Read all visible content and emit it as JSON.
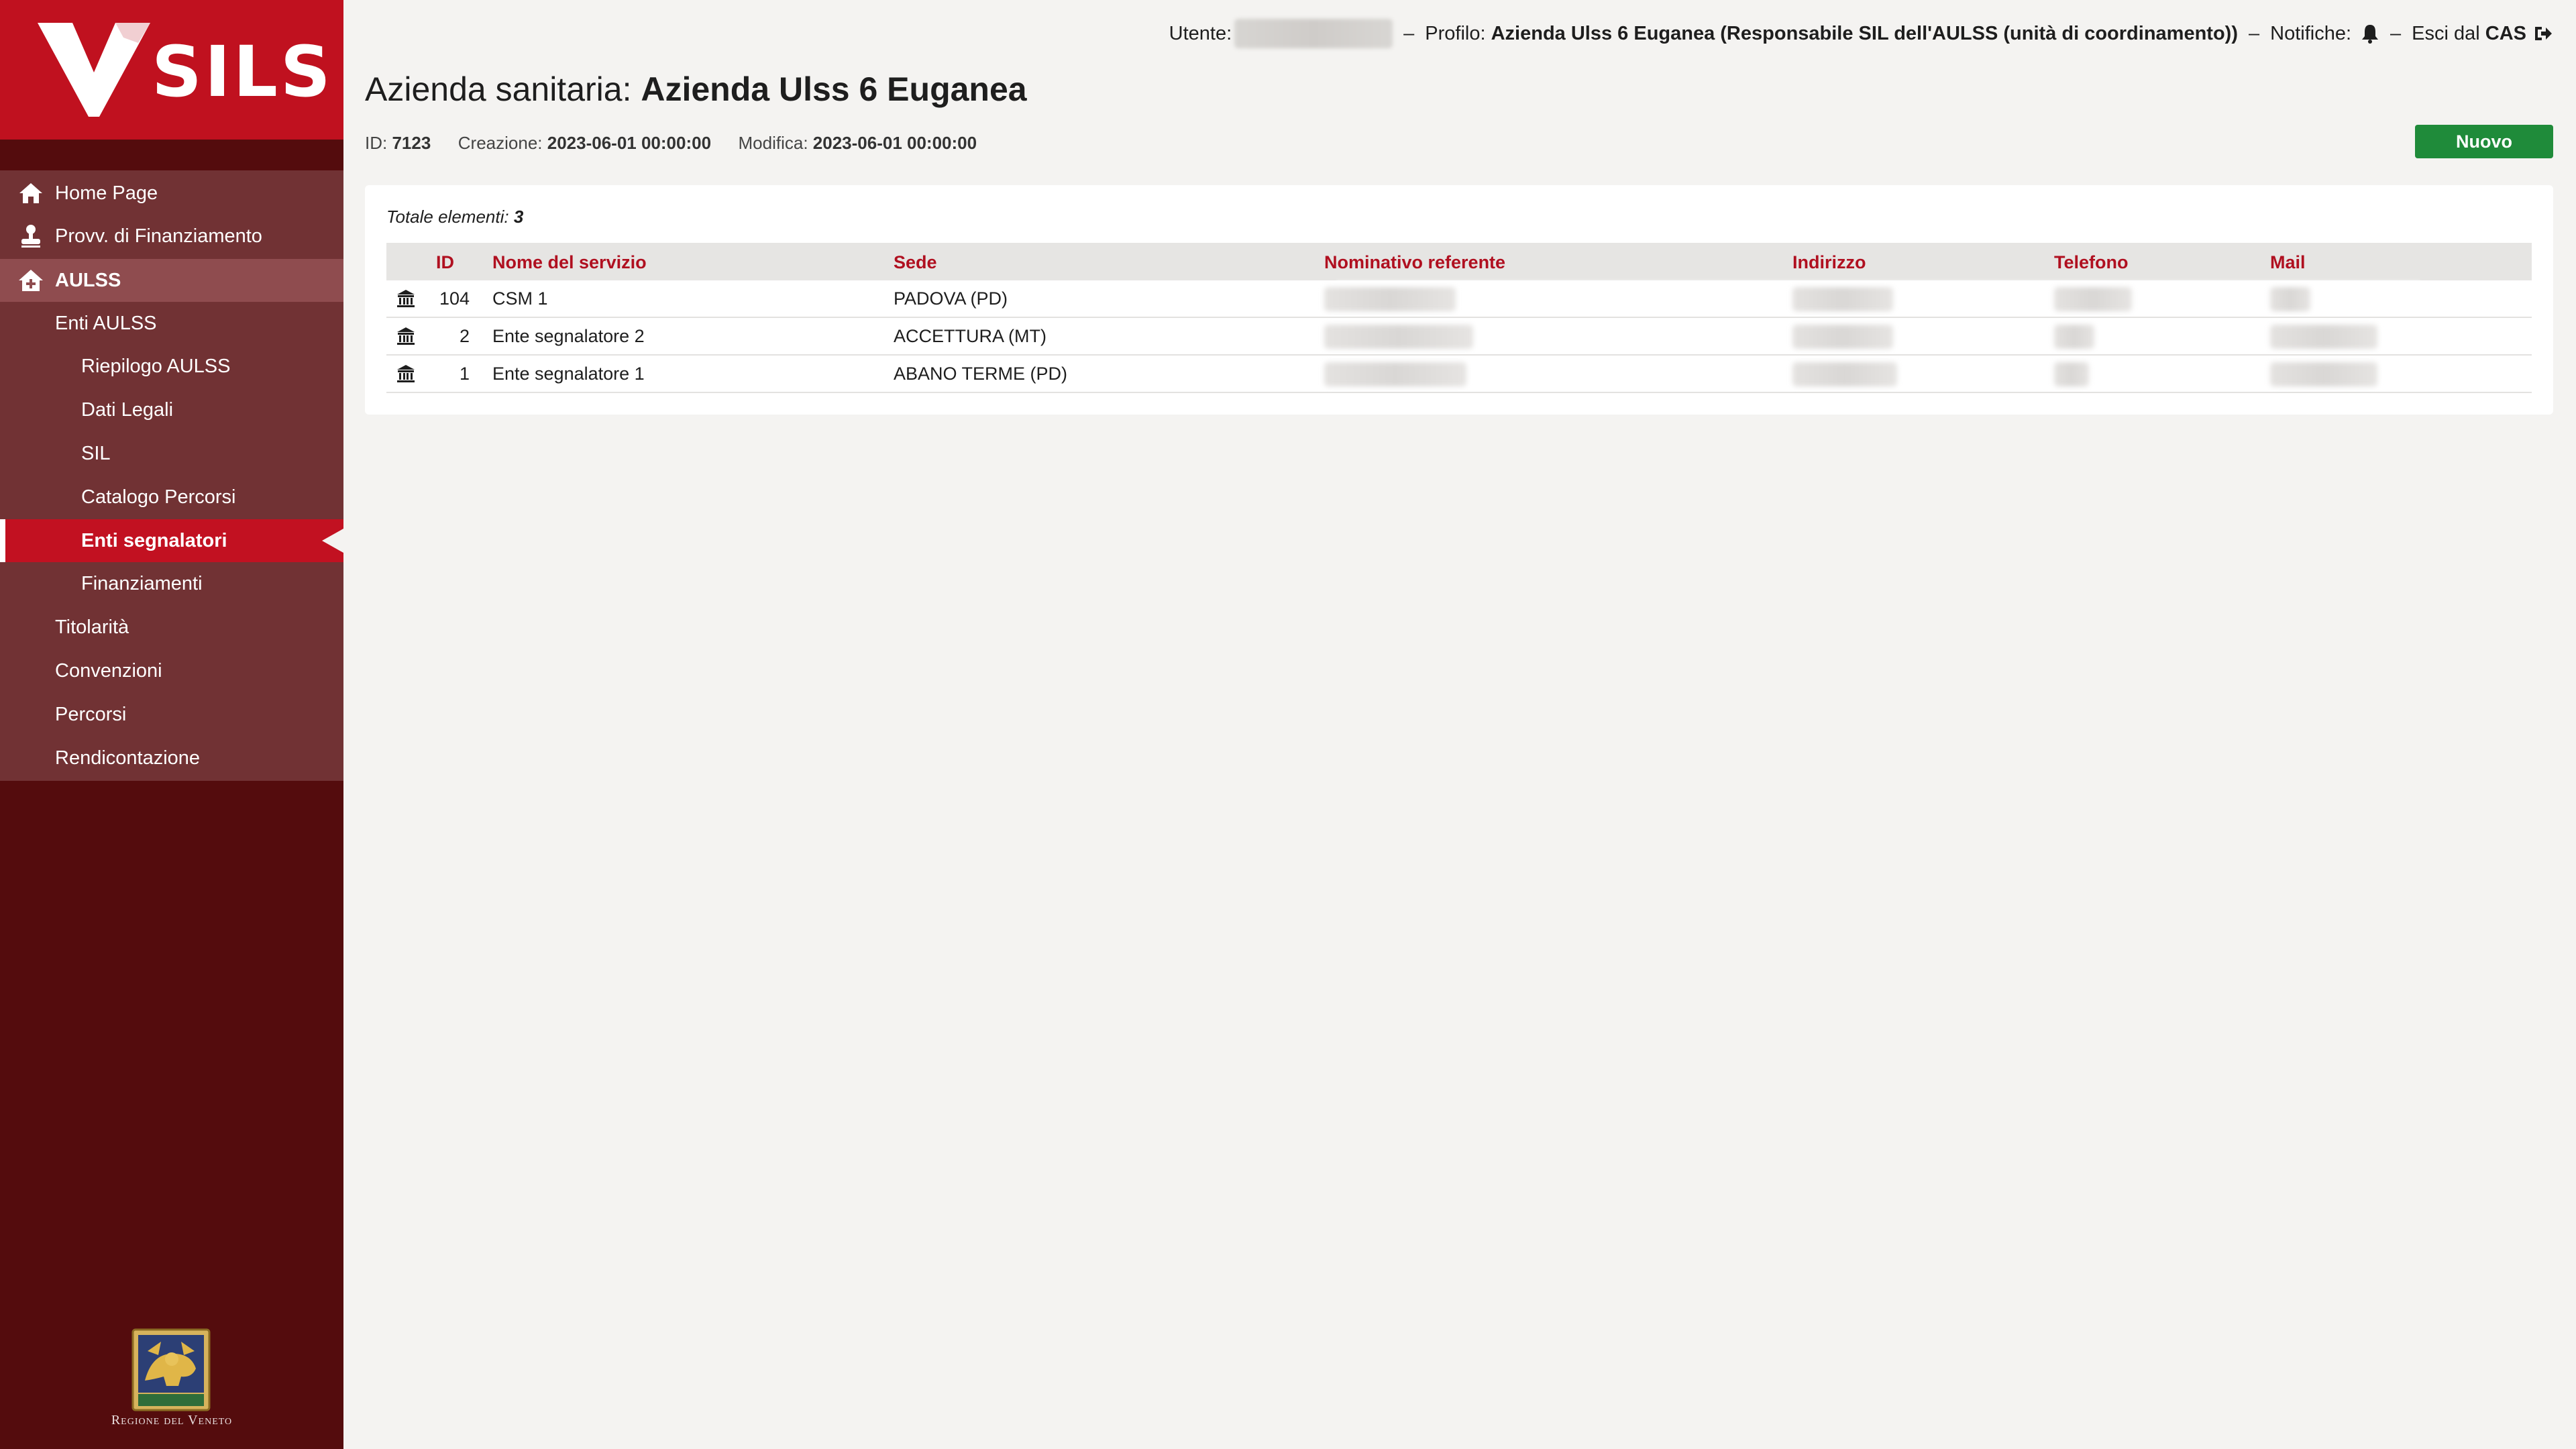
{
  "app": {
    "logo_text": "SILS"
  },
  "topbar": {
    "user_label": "Utente:",
    "profile_label": "Profilo:",
    "profile_value": "Azienda Ulss 6 Euganea (Responsabile SIL dell'AULSS (unità di coordinamento))",
    "notifications_label": "Notifiche:",
    "logout_prefix": "Esci dal",
    "logout_strong": "CAS",
    "separator": "–"
  },
  "sidebar": {
    "items": [
      {
        "label": "Home Page",
        "icon": "home-icon"
      },
      {
        "label": "Provv. di Finanziamento",
        "icon": "stamp-icon"
      },
      {
        "label": "AULSS",
        "icon": "house-plus-icon"
      },
      {
        "label": "Enti AULSS"
      },
      {
        "label": "Riepilogo AULSS"
      },
      {
        "label": "Dati Legali"
      },
      {
        "label": "SIL"
      },
      {
        "label": "Catalogo Percorsi"
      },
      {
        "label": "Enti segnalatori"
      },
      {
        "label": "Finanziamenti"
      },
      {
        "label": "Titolarità"
      },
      {
        "label": "Convenzioni"
      },
      {
        "label": "Percorsi"
      },
      {
        "label": "Rendicontazione"
      }
    ],
    "crest_caption": "Regione del Veneto"
  },
  "header": {
    "title_prefix": "Azienda sanitaria:",
    "title_strong": "Azienda Ulss 6 Euganea",
    "id_label": "ID:",
    "id_value": "7123",
    "created_label": "Creazione:",
    "created_value": "2023-06-01 00:00:00",
    "modified_label": "Modifica:",
    "modified_value": "2023-06-01 00:00:00",
    "new_button": "Nuovo"
  },
  "table": {
    "total_label": "Totale elementi:",
    "total_value": "3",
    "columns": [
      "ID",
      "Nome del servizio",
      "Sede",
      "Nominativo referente",
      "Indirizzo",
      "Telefono",
      "Mail"
    ],
    "rows": [
      {
        "id": "104",
        "nome": "CSM 1",
        "sede": "PADOVA (PD)"
      },
      {
        "id": "2",
        "nome": "Ente segnalatore 2",
        "sede": "ACCETTURA (MT)"
      },
      {
        "id": "1",
        "nome": "Ente segnalatore 1",
        "sede": "ABANO TERME (PD)"
      }
    ]
  },
  "colors": {
    "brand_red": "#c0111f",
    "sidebar_dark": "#540c0d",
    "accent_green": "#1f8b3a",
    "header_red": "#b01020"
  }
}
